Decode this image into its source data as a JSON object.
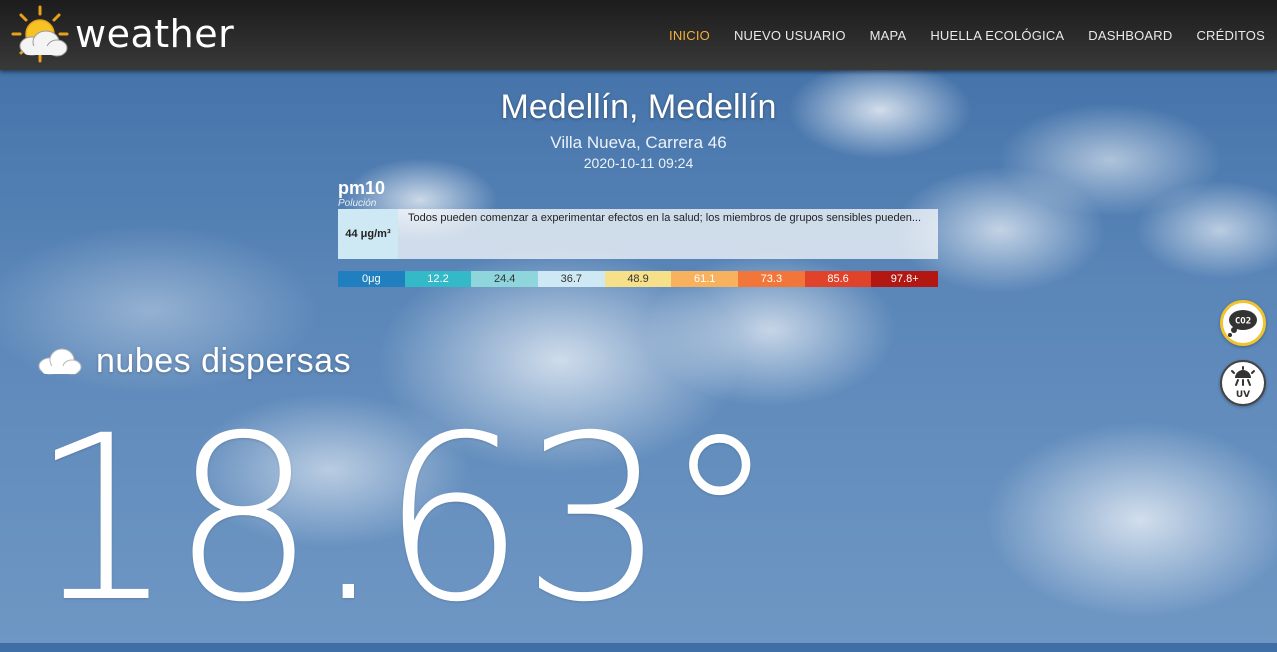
{
  "app": {
    "title": "weather",
    "logo_icon": "sun-cloud-icon"
  },
  "nav": {
    "items": [
      {
        "label": "INICIO",
        "active": true
      },
      {
        "label": "NUEVO USUARIO",
        "active": false
      },
      {
        "label": "MAPA",
        "active": false
      },
      {
        "label": "HUELLA ECOLÓGICA",
        "active": false
      },
      {
        "label": "DASHBOARD",
        "active": false
      },
      {
        "label": "CRÉDITOS",
        "active": false
      }
    ],
    "active_color": "#f2b13a"
  },
  "location": {
    "city": "Medellín, Medellín",
    "address": "Villa Nueva, Carrera 46",
    "datetime": "2020-10-11 09:24"
  },
  "pollution": {
    "name": "pm10",
    "subtitle": "Polución",
    "value": "44 μg/m³",
    "description": "Todos pueden comenzar a experimentar efectos en la salud; los miembros de grupos sensibles pueden...",
    "scale": [
      {
        "label": "0μg",
        "bg": "#1f7fbf",
        "fg": "#ffffff"
      },
      {
        "label": "12.2",
        "bg": "#33b9c7",
        "fg": "#ffffff"
      },
      {
        "label": "24.4",
        "bg": "#8fd6dc",
        "fg": "#333333"
      },
      {
        "label": "36.7",
        "bg": "#cfe9f4",
        "fg": "#333333"
      },
      {
        "label": "48.9",
        "bg": "#f7e08a",
        "fg": "#333333"
      },
      {
        "label": "61.1",
        "bg": "#f8b15c",
        "fg": "#ffffff"
      },
      {
        "label": "73.3",
        "bg": "#f2763a",
        "fg": "#ffffff"
      },
      {
        "label": "85.6",
        "bg": "#e0422a",
        "fg": "#ffffff"
      },
      {
        "label": "97.8+",
        "bg": "#b31712",
        "fg": "#ffffff"
      }
    ]
  },
  "weather": {
    "condition": "nubes dispersas",
    "condition_icon": "cloud-icon",
    "temperature": "18.63°"
  },
  "side_buttons": {
    "co2": {
      "label": "CO2",
      "icon": "co2-cloud-icon",
      "ring_color": "#f0c430"
    },
    "uv": {
      "label": "UV",
      "icon": "uv-sun-icon"
    }
  }
}
